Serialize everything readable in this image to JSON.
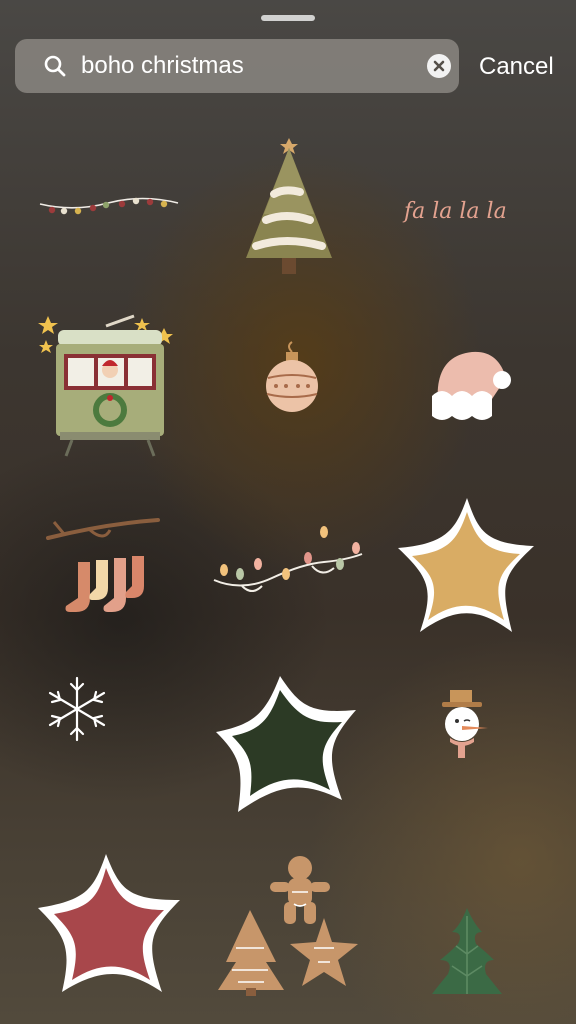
{
  "search": {
    "query": "boho christmas",
    "cancel_label": "Cancel"
  },
  "stickers": [
    {
      "name": "string-lights"
    },
    {
      "name": "christmas-tree"
    },
    {
      "name": "fa-la-la-la",
      "text": "fa la la la"
    },
    {
      "name": "santa-tram"
    },
    {
      "name": "bauble-ornament"
    },
    {
      "name": "santa-hat"
    },
    {
      "name": "hanging-stockings"
    },
    {
      "name": "fairy-lights"
    },
    {
      "name": "mustard-star"
    },
    {
      "name": "snowflake"
    },
    {
      "name": "green-star"
    },
    {
      "name": "snowman"
    },
    {
      "name": "red-star"
    },
    {
      "name": "gingerbread-cookies"
    },
    {
      "name": "green-pine-tree"
    }
  ],
  "colors": {
    "mustard": "#d9ac64",
    "dark_green": "#2c3a25",
    "berry_red": "#a8474b",
    "pink": "#e3a28f",
    "gingerbread": "#c7966a"
  }
}
